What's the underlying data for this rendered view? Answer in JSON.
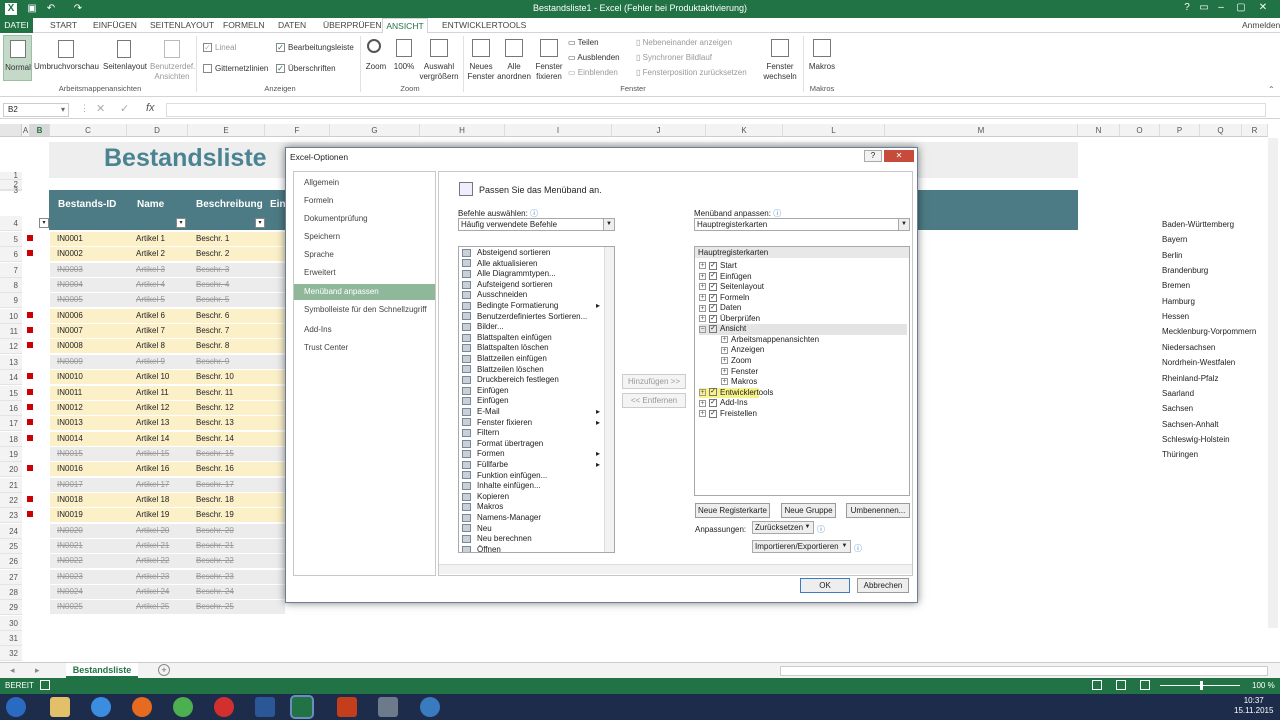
{
  "app": {
    "title": "Bestandsliste1 - Excel (Fehler bei Produktaktivierung)",
    "signin": "Anmelden",
    "accent": "#217346"
  },
  "ribbon_tabs": [
    "DATEI",
    "START",
    "EINFÜGEN",
    "SEITENLAYOUT",
    "FORMELN",
    "DATEN",
    "ÜBERPRÜFEN",
    "ANSICHT",
    "ENTWICKLERTOOLS"
  ],
  "ribbon": {
    "views": {
      "normal": "Normal",
      "umbruch": "Umbruchvorschau",
      "seitenlayout": "Seitenlayout",
      "benutzerdef": "Benutzerdef. Ansichten",
      "group": "Arbeitsmappenansichten"
    },
    "show": {
      "lineal": "Lineal",
      "bearbeitungsleiste": "Bearbeitungsleiste",
      "gitternetzlinien": "Gitternetzlinien",
      "ueberschriften": "Überschriften",
      "group": "Anzeigen"
    },
    "zoom": {
      "zoom": "Zoom",
      "hundert": "100%",
      "auswahl": "Auswahl vergrößern",
      "group": "Zoom"
    },
    "window": {
      "neues": "Neues Fenster",
      "alle": "Alle anordnen",
      "fixieren": "Fenster fixieren",
      "teilen": "Teilen",
      "ausblenden": "Ausblenden",
      "einblenden": "Einblenden",
      "nebeneinander": "Nebeneinander anzeigen",
      "synchron": "Synchroner Bildlauf",
      "position": "Fensterposition zurücksetzen",
      "wechseln": "Fenster wechseln",
      "group": "Fenster"
    },
    "macros": {
      "makros": "Makros",
      "group": "Makros"
    }
  },
  "formula_bar": {
    "namebox": "B2",
    "fx": "fx"
  },
  "columns": [
    "A",
    "B",
    "C",
    "D",
    "E",
    "F",
    "G",
    "H",
    "I",
    "J",
    "K",
    "L",
    "M",
    "N",
    "O",
    "P",
    "Q",
    "R"
  ],
  "sheet": {
    "title": "Bestandsliste",
    "headers": [
      "Bestands-ID",
      "Name",
      "Beschreibung",
      "Ein"
    ],
    "rows": [
      {
        "n": "5",
        "id": "IN0001",
        "name": "Artikel 1",
        "desc": "Beschr. 1",
        "s": false
      },
      {
        "n": "6",
        "id": "IN0002",
        "name": "Artikel 2",
        "desc": "Beschr. 2",
        "s": false
      },
      {
        "n": "7",
        "id": "IN0003",
        "name": "Artikel 3",
        "desc": "Beschr. 3",
        "s": true
      },
      {
        "n": "8",
        "id": "IN0004",
        "name": "Artikel 4",
        "desc": "Beschr. 4",
        "s": true
      },
      {
        "n": "9",
        "id": "IN0005",
        "name": "Artikel 5",
        "desc": "Beschr. 5",
        "s": true
      },
      {
        "n": "10",
        "id": "IN0006",
        "name": "Artikel 6",
        "desc": "Beschr. 6",
        "s": false
      },
      {
        "n": "11",
        "id": "IN0007",
        "name": "Artikel 7",
        "desc": "Beschr. 7",
        "s": false
      },
      {
        "n": "12",
        "id": "IN0008",
        "name": "Artikel 8",
        "desc": "Beschr. 8",
        "s": false
      },
      {
        "n": "13",
        "id": "IN0009",
        "name": "Artikel 9",
        "desc": "Beschr. 9",
        "s": true
      },
      {
        "n": "14",
        "id": "IN0010",
        "name": "Artikel 10",
        "desc": "Beschr. 10",
        "s": false
      },
      {
        "n": "15",
        "id": "IN0011",
        "name": "Artikel 11",
        "desc": "Beschr. 11",
        "s": false
      },
      {
        "n": "16",
        "id": "IN0012",
        "name": "Artikel 12",
        "desc": "Beschr. 12",
        "s": false
      },
      {
        "n": "17",
        "id": "IN0013",
        "name": "Artikel 13",
        "desc": "Beschr. 13",
        "s": false
      },
      {
        "n": "18",
        "id": "IN0014",
        "name": "Artikel 14",
        "desc": "Beschr. 14",
        "s": false
      },
      {
        "n": "19",
        "id": "IN0015",
        "name": "Artikel 15",
        "desc": "Beschr. 15",
        "s": true
      },
      {
        "n": "20",
        "id": "IN0016",
        "name": "Artikel 16",
        "desc": "Beschr. 16",
        "s": false
      },
      {
        "n": "21",
        "id": "IN0017",
        "name": "Artikel 17",
        "desc": "Beschr. 17",
        "s": true
      },
      {
        "n": "22",
        "id": "IN0018",
        "name": "Artikel 18",
        "desc": "Beschr. 18",
        "s": false
      },
      {
        "n": "23",
        "id": "IN0019",
        "name": "Artikel 19",
        "desc": "Beschr. 19",
        "s": false
      },
      {
        "n": "24",
        "id": "IN0020",
        "name": "Artikel 20",
        "desc": "Beschr. 20",
        "s": true
      },
      {
        "n": "25",
        "id": "IN0021",
        "name": "Artikel 21",
        "desc": "Beschr. 21",
        "s": true
      },
      {
        "n": "26",
        "id": "IN0022",
        "name": "Artikel 22",
        "desc": "Beschr. 22",
        "s": true
      },
      {
        "n": "27",
        "id": "IN0023",
        "name": "Artikel 23",
        "desc": "Beschr. 23",
        "s": true
      },
      {
        "n": "28",
        "id": "IN0024",
        "name": "Artikel 24",
        "desc": "Beschr. 24",
        "s": true
      },
      {
        "n": "29",
        "id": "IN0025",
        "name": "Artikel 25",
        "desc": "Beschr. 25",
        "s": true
      }
    ],
    "states": [
      "Baden-Württemberg",
      "Bayern",
      "Berlin",
      "Brandenburg",
      "Bremen",
      "Hamburg",
      "Hessen",
      "Mecklenburg-Vorpommern",
      "Niedersachsen",
      "Nordrhein-Westfalen",
      "Rheinland-Pfalz",
      "Saarland",
      "Sachsen",
      "Sachsen-Anhalt",
      "Schleswig-Holstein",
      "Thüringen"
    ]
  },
  "sheet_tabs": {
    "active": "Bestandsliste"
  },
  "status": {
    "mode": "BEREIT",
    "zoom": "100 %"
  },
  "clock": {
    "time": "10:37",
    "date": "15.11.2015"
  },
  "dialog": {
    "title": "Excel-Optionen",
    "help": "?",
    "nav": [
      "Allgemein",
      "Formeln",
      "Dokumentprüfung",
      "Speichern",
      "Sprache",
      "Erweitert",
      "Menüband anpassen",
      "Symbolleiste für den Schnellzugriff",
      "Add-Ins",
      "Trust Center"
    ],
    "nav_selected": 6,
    "heading": "Passen Sie das Menüband an.",
    "left_label": "Befehle auswählen:",
    "left_select": "Häufig verwendete Befehle",
    "right_label": "Menüband anpassen:",
    "right_select": "Hauptregisterkarten",
    "commands": [
      "Absteigend sortieren",
      "Alle aktualisieren",
      "Alle Diagrammtypen...",
      "Aufsteigend sortieren",
      "Ausschneiden",
      "Bedingte Formatierung",
      "Benutzerdefiniertes Sortieren...",
      "Bilder...",
      "Blattspalten einfügen",
      "Blattspalten löschen",
      "Blattzeilen einfügen",
      "Blattzeilen löschen",
      "Druckbereich festlegen",
      "Einfügen",
      "Einfügen",
      "E-Mail",
      "Fenster fixieren",
      "Filtern",
      "Format übertragen",
      "Formen",
      "Füllfarbe",
      "Funktion einfügen...",
      "Inhalte einfügen...",
      "Kopieren",
      "Makros",
      "Namens-Manager",
      "Neu",
      "Neu berechnen",
      "Öffnen"
    ],
    "add_btn": "Hinzufügen >>",
    "remove_btn": "<< Entfernen",
    "tree_header": "Hauptregisterkarten",
    "tree": [
      "Start",
      "Einfügen",
      "Seitenlayout",
      "Formeln",
      "Daten",
      "Überprüfen",
      "Ansicht",
      "Arbeitsmappenansichten",
      "Anzeigen",
      "Zoom",
      "Fenster",
      "Makros",
      "Entwicklertools",
      "Add-Ins",
      "Freistellen"
    ],
    "new_tab": "Neue Registerkarte",
    "new_group": "Neue Gruppe",
    "rename": "Umbenennen...",
    "customizations": "Anpassungen:",
    "reset": "Zurücksetzen",
    "import_export": "Importieren/Exportieren",
    "ok": "OK",
    "cancel": "Abbrechen"
  }
}
